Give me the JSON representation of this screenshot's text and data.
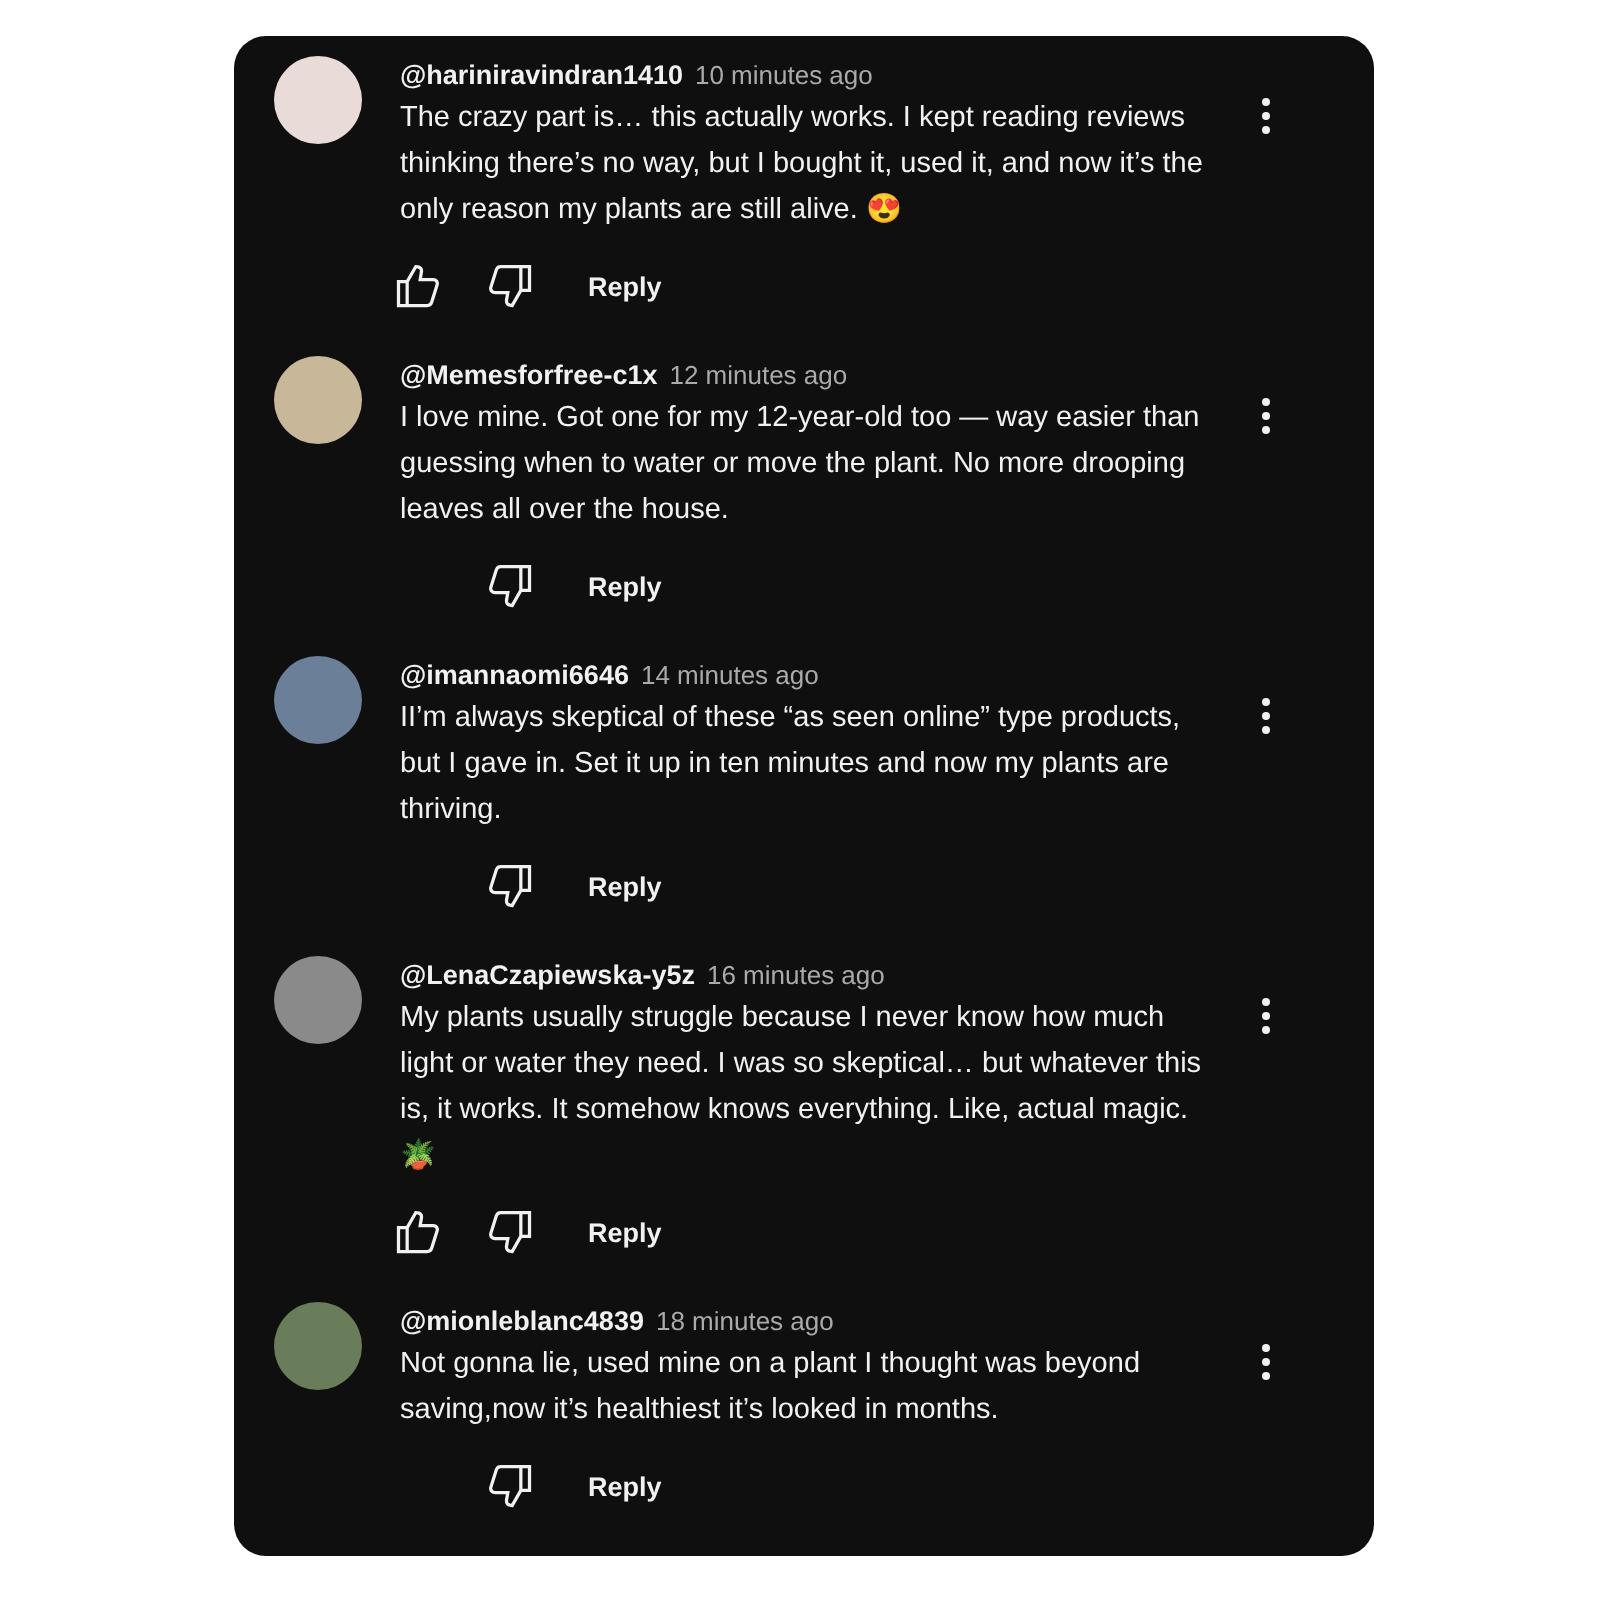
{
  "comments": [
    {
      "username": "@hariniravindran1410",
      "time": "10 minutes ago",
      "text": "The crazy part is… this actually works. I kept reading reviews thinking there’s no way, but I bought it, used it, and now it’s the only reason my plants are still alive. 😍",
      "like_button": true,
      "reply": "Reply"
    },
    {
      "username": "@Memesforfree-c1x",
      "time": "12 minutes ago",
      "text": "I love mine. Got one for my 12-year-old too — way easier than guessing when to water or move the plant. No more drooping leaves all over the house.",
      "like_button": false,
      "reply": "Reply"
    },
    {
      "username": "@imannaomi6646",
      "time": "14 minutes ago",
      "text": "II’m always skeptical of these “as seen online” type products, but I gave in. Set it up in ten minutes and now my plants are thriving.",
      "like_button": false,
      "reply": "Reply"
    },
    {
      "username": "@LenaCzapiewska-y5z",
      "time": "16 minutes ago",
      "text": "My plants usually struggle because I never know how much light or water they need. I was so skeptical… but whatever this is, it works. It somehow knows everything. Like, actual magic. 🪴",
      "like_button": true,
      "reply": "Reply"
    },
    {
      "username": "@mionleblanc4839",
      "time": "18 minutes ago",
      "text": "Not gonna lie, used mine on a plant I thought was beyond saving,now it’s healthiest it’s looked in months.",
      "like_button": false,
      "reply": "Reply"
    }
  ]
}
